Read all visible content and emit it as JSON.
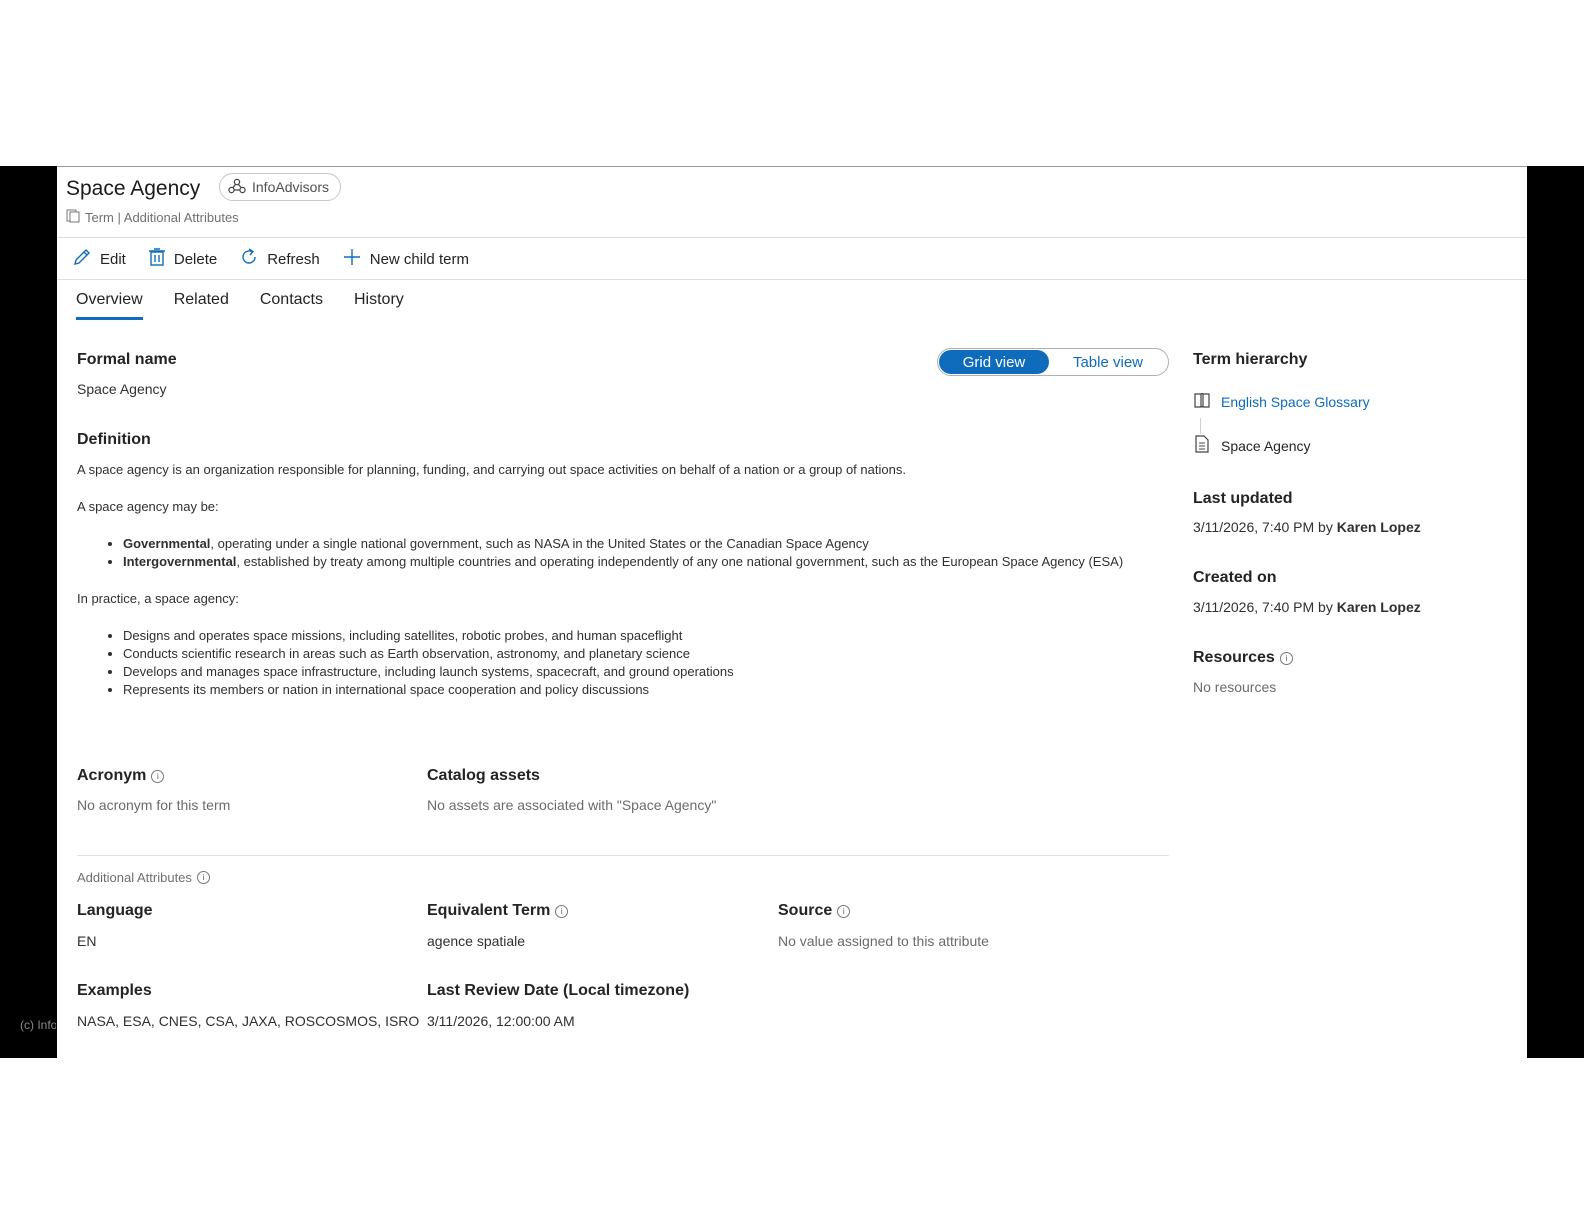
{
  "header": {
    "title": "Space Agency",
    "chip_label": "InfoAdvisors",
    "subtitle": "Term | Additional Attributes"
  },
  "toolbar": {
    "edit": "Edit",
    "delete": "Delete",
    "refresh": "Refresh",
    "new_child": "New child term"
  },
  "tabs": [
    "Overview",
    "Related",
    "Contacts",
    "History"
  ],
  "view_toggle": {
    "grid": "Grid view",
    "table": "Table view",
    "selected": "Grid view"
  },
  "overview": {
    "formal_name_label": "Formal name",
    "formal_name_value": "Space Agency",
    "definition_label": "Definition",
    "definition": {
      "p1": "A space agency is an organization responsible for planning, funding, and carrying out space activities on behalf of a nation or a group of nations.",
      "p2": "A space agency may be:",
      "b1_bold": "Governmental",
      "b1_rest": ", operating under a single national government, such as NASA in the United States or the Canadian Space Agency",
      "b2_bold": "Intergovernmental",
      "b2_rest": ", established by treaty among multiple countries and operating independently of any one national government, such as the European Space Agency (ESA)",
      "p3": "In practice, a space agency:",
      "list": [
        "Designs and operates space missions, including satellites, robotic probes, and human spaceflight",
        "Conducts scientific research in areas such as Earth observation, astronomy, and planetary science",
        "Develops and manages space infrastructure, including launch systems, spacecraft, and ground operations",
        "Represents its members or nation in international space cooperation and policy discussions"
      ]
    },
    "acronym_label": "Acronym",
    "acronym_value": "No acronym for this term",
    "catalog_label": "Catalog assets",
    "catalog_value": "No assets are associated with \"Space Agency\"",
    "additional_label": "Additional Attributes",
    "language_label": "Language",
    "language_value": "EN",
    "equivalent_label": "Equivalent Term",
    "equivalent_value": "agence spatiale",
    "source_label": "Source",
    "source_value": "No value assigned to this attribute",
    "examples_label": "Examples",
    "examples_value": "NASA, ESA, CNES, CSA, JAXA, ROSCOSMOS, ISRO",
    "review_label": "Last Review Date (Local timezone)",
    "review_value": "3/11/2026, 12:00:00 AM"
  },
  "sidebar": {
    "hierarchy_label": "Term hierarchy",
    "glossary": "English Space Glossary",
    "term": "Space Agency",
    "last_updated_label": "Last updated",
    "last_updated_date": "3/11/2026, 7:40 PM by ",
    "last_updated_user": "Karen Lopez",
    "created_label": "Created on",
    "created_date": "3/11/2026, 7:40 PM by ",
    "created_user": "Karen Lopez",
    "resources_label": "Resources",
    "resources_value": "No resources"
  },
  "footer": {
    "copyright": "(c) InfoAdvisors"
  },
  "colors": {
    "accent": "#0f6cbd",
    "text": "#242424",
    "muted": "#6b6b6b"
  },
  "icons": [
    "terms-icon",
    "edit-icon",
    "delete-icon",
    "refresh-icon",
    "plus-icon",
    "info-icon",
    "glossary-book-icon",
    "document-icon",
    "network-icon"
  ]
}
